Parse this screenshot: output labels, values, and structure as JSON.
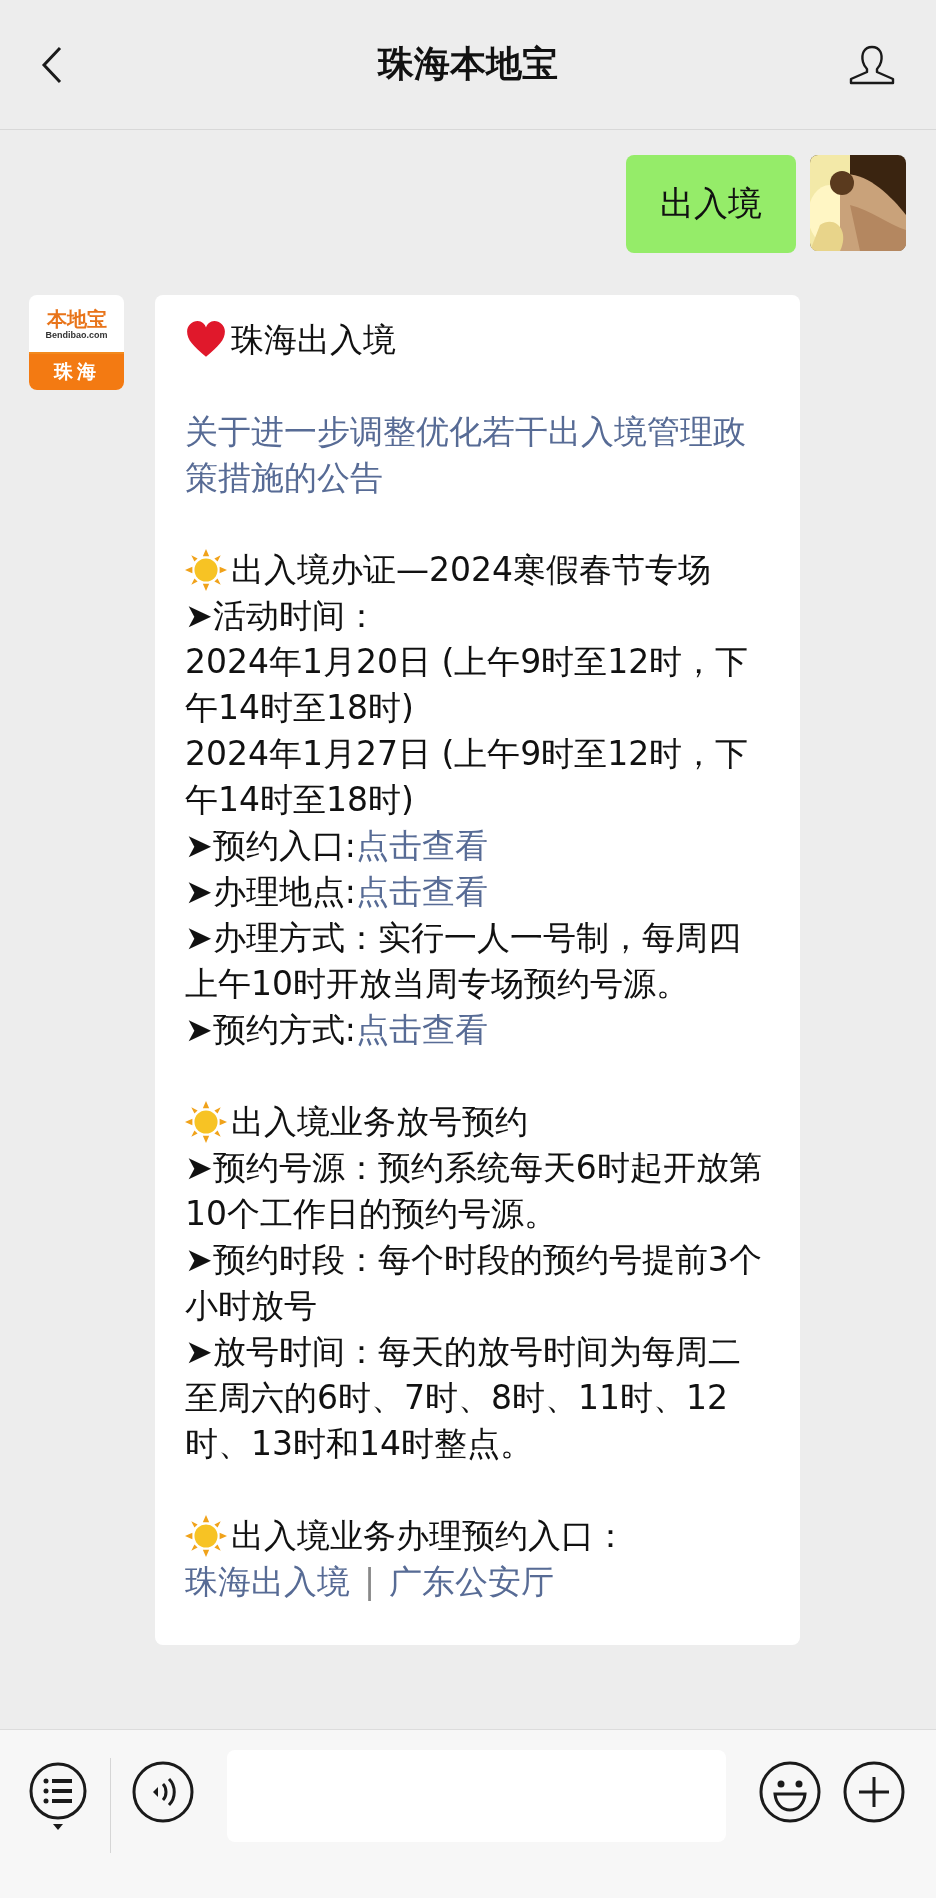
{
  "header": {
    "title": "珠海本地宝"
  },
  "messages": [
    {
      "kind": "user",
      "text": "出入境"
    },
    {
      "kind": "bot",
      "logo": {
        "brand": "本地宝",
        "domain": "Bendibao.com",
        "city": "珠海"
      },
      "title": "珠海出入境",
      "announcement": "关于进一步调整优化若干出入境管理政策措施的公告",
      "sections": [
        {
          "heading": "出入境办证—2024寒假春节专场",
          "items": [
            {
              "kind": "text",
              "text": "➤活动时间："
            },
            {
              "kind": "text",
              "text": "2024年1月20日 (上午9时至12时，下午14时至18时)"
            },
            {
              "kind": "text",
              "text": "2024年1月27日 (上午9时至12时，下午14时至18时)"
            },
            {
              "kind": "field",
              "label": "➤预约入口:",
              "link": "点击查看"
            },
            {
              "kind": "field",
              "label": "➤办理地点:",
              "link": "点击查看"
            },
            {
              "kind": "text",
              "text": "➤办理方式：实行一人一号制，每周四上午10时开放当周专场预约号源。"
            },
            {
              "kind": "field",
              "label": "➤预约方式:",
              "link": "点击查看"
            }
          ]
        },
        {
          "heading": "出入境业务放号预约",
          "items": [
            {
              "kind": "text",
              "text": "➤预约号源：预约系统每天6时起开放第10个工作日的预约号源。"
            },
            {
              "kind": "text",
              "text": "➤预约时段：每个时段的预约号提前3个小时放号"
            },
            {
              "kind": "text",
              "text": "➤放号时间：每天的放号时间为每周二至周六的6时、7时、8时、11时、12时、13时和14时整点。"
            }
          ]
        },
        {
          "heading": "出入境业务办理预约入口：",
          "items": [
            {
              "kind": "links",
              "links": [
                "珠海出入境",
                "广东公安厅"
              ],
              "separator": "|"
            }
          ]
        }
      ]
    }
  ]
}
